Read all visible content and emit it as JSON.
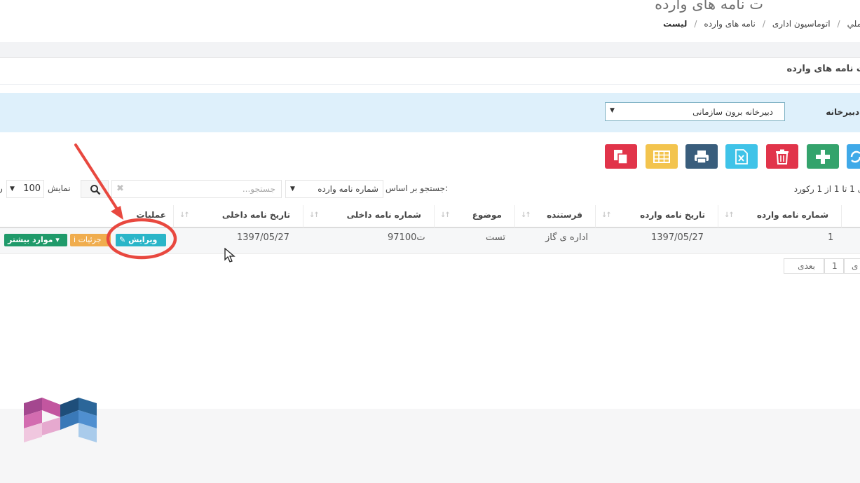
{
  "header": {
    "title": "ت نامه های وارده",
    "breadcrumb": [
      "ملي",
      "اتوماسیون اداری",
      "نامه های وارده",
      "لیست"
    ]
  },
  "panel": {
    "title": "ت نامه های وارده"
  },
  "filter": {
    "label": "دبیرخانه:",
    "selected": "دبیرخانه برون سازمانی"
  },
  "toolbar": {
    "buttons": [
      {
        "name": "copy",
        "color": "#e1344a"
      },
      {
        "name": "columns",
        "color": "#f3c44e"
      },
      {
        "name": "print",
        "color": "#395d7c"
      },
      {
        "name": "excel",
        "color": "#3fc3e8"
      },
      {
        "name": "delete",
        "color": "#e1344a"
      },
      {
        "name": "add",
        "color": "#34a36c"
      },
      {
        "name": "refresh",
        "color": "#3fa9e8"
      }
    ]
  },
  "search": {
    "records_info": "ی 1 تا 1 از 1 رکورد",
    "by_label": "جستجو بر اساس:",
    "by_selected": "شماره نامه وارده",
    "placeholder": "جستجو...",
    "show_label": "نمایش",
    "show_value": "100",
    "show_suffix": "ر"
  },
  "table": {
    "columns": [
      "شماره نامه وارده",
      "تاریخ نامه وارده",
      "فرستنده",
      "موضوع",
      "شماره نامه داخلی",
      "تاریخ نامه داخلی",
      "عملیات"
    ],
    "rows": [
      {
        "number": "1",
        "date": "1397/05/27",
        "sender": "اداره ی گاز",
        "subject": "تست",
        "internal_number": "97ت100",
        "internal_date": "1397/05/27",
        "actions": {
          "edit": "ویرایش",
          "details": "جزئیات",
          "more": "موارد بیشتر"
        }
      }
    ]
  },
  "pagination": {
    "prev": "ی",
    "page": "1",
    "next": "بعدی"
  }
}
